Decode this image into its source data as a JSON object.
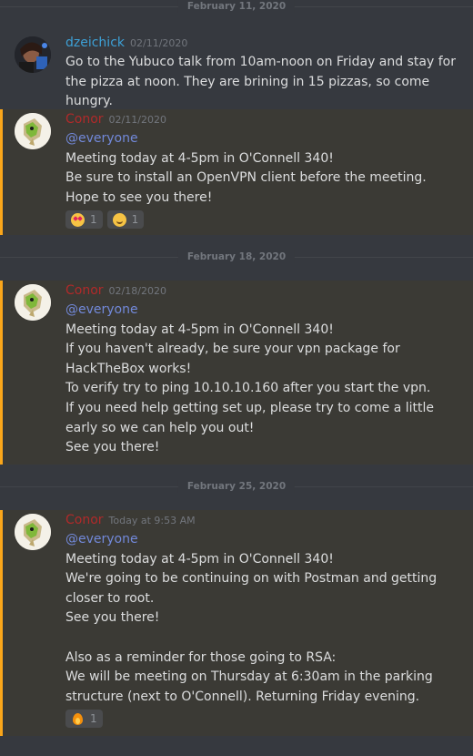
{
  "dividers": [
    "February 11, 2020",
    "February 18, 2020",
    "February 25, 2020"
  ],
  "colors": {
    "background": "#36393f",
    "mention_highlight": "#3b3a35",
    "mention_bar": "#faa61a",
    "author_dzeichick": "#3da0d6",
    "author_conor": "#b02a2a",
    "mention_text": "#7289da"
  },
  "messages": [
    {
      "author": "dzeichick",
      "timestamp": "02/11/2020",
      "lines": [
        "Go to the Yubuco talk from 10am-noon on Friday and stay for the pizza at noon. They are brining in 15 pizzas, so come hungry."
      ]
    },
    {
      "author": "Conor",
      "timestamp": "02/11/2020",
      "mention": "@everyone",
      "lines": [
        "Meeting today at 4-5pm in O'Connell 340!",
        "Be sure to install an OpenVPN client before the meeting.",
        "Hope to see you there!"
      ],
      "reactions": [
        {
          "emoji": "heart-eyes-icon",
          "count": "1"
        },
        {
          "emoji": "smiling-face-icon",
          "count": "1"
        }
      ]
    },
    {
      "author": "Conor",
      "timestamp": "02/18/2020",
      "mention": "@everyone",
      "lines": [
        "Meeting today at 4-5pm in O'Connell 340!",
        "If you haven't already, be sure your vpn package for HackTheBox works!",
        "To verify try to ping 10.10.10.160 after you start the vpn.",
        "If you need help getting set up, please try to come a little early so we can help you out!",
        "See you there!"
      ]
    },
    {
      "author": "Conor",
      "timestamp": "Today at 9:53 AM",
      "mention": "@everyone",
      "lines": [
        "Meeting today at 4-5pm in O'Connell 340!",
        "We're going to be continuing on with Postman and getting closer to root.",
        "See you there!",
        "",
        "Also as a reminder for those going to RSA:",
        "We will be meeting on Thursday at 6:30am in the parking structure (next to O'Connell). Returning Friday evening."
      ],
      "reactions": [
        {
          "emoji": "fire-icon",
          "count": "1"
        }
      ]
    }
  ]
}
